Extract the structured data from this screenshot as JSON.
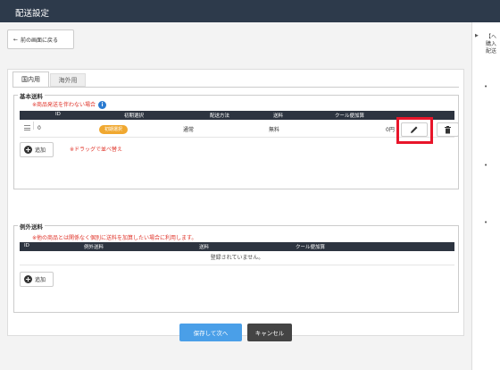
{
  "header": {
    "title": "配送設定"
  },
  "back_button": {
    "label": "前の画面に戻る"
  },
  "tabs": [
    {
      "label": "国内用",
      "active": true
    },
    {
      "label": "海外用",
      "active": false
    }
  ],
  "basic_shipping": {
    "legend": "基本送料",
    "note": "※商品発送を伴わない場合",
    "columns": [
      "ID",
      "初期選択",
      "配送方法",
      "送料",
      "クール便加算"
    ],
    "rows": [
      {
        "id": "0",
        "default_badge": "初期選択",
        "method": "通常",
        "fee": "無料",
        "cool": "0円"
      }
    ],
    "add_label": "追加",
    "drag_note": "※ドラッグで並べ替え"
  },
  "exception_shipping": {
    "legend": "例外送料",
    "note": "※他の商品とは関係なく個別に送料を加算したい場合に利用します。",
    "columns": [
      "ID",
      "例外送料",
      "送料",
      "クール便加算"
    ],
    "empty_text": "登録されていません。",
    "add_label": "追加"
  },
  "footer": {
    "save_label": "保存して次へ",
    "cancel_label": "キャンセル"
  },
  "side_help": {
    "lines": [
      "【ヘ",
      "購入",
      "配送"
    ],
    "bullets": [
      "•",
      "•",
      "•"
    ]
  },
  "colors": {
    "topbar": "#2d3a4b",
    "accent_red": "#e0342a",
    "highlight": "#e8152a",
    "save_blue": "#4a9fe8",
    "badge_orange": "#f0a830"
  }
}
